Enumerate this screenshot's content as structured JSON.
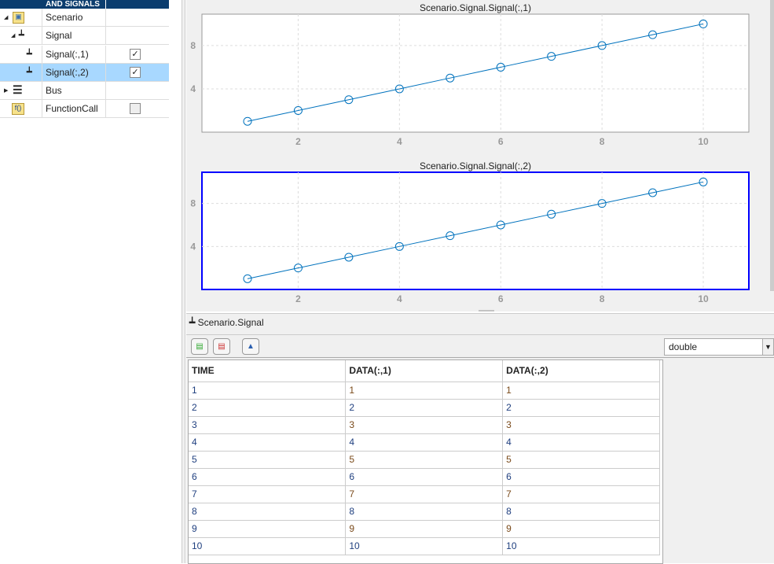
{
  "tree": {
    "header": "AND SIGNALS",
    "items": [
      {
        "label": "Scenario",
        "icon": "scenario-icon",
        "expanded": true
      },
      {
        "label": "Signal",
        "icon": "signal-icon",
        "expanded": true
      },
      {
        "label": "Signal(:,1)",
        "icon": "signal-icon",
        "checked": true
      },
      {
        "label": "Signal(:,2)",
        "icon": "signal-icon",
        "checked": true,
        "selected": true
      },
      {
        "label": "Bus",
        "icon": "bus-icon",
        "expanded": false
      },
      {
        "label": "FunctionCall",
        "icon": "function-call-icon",
        "checked": false
      }
    ]
  },
  "checkmark": "✓",
  "chart_data": [
    {
      "type": "line",
      "title": "Scenario.Signal.Signal(:,1)",
      "x": [
        1,
        2,
        3,
        4,
        5,
        6,
        7,
        8,
        9,
        10
      ],
      "y": [
        1,
        2,
        3,
        4,
        5,
        6,
        7,
        8,
        9,
        10
      ],
      "xticks": [
        2,
        4,
        6,
        8,
        10
      ],
      "yticks": [
        4,
        8
      ],
      "xlim": [
        0.1,
        10.9
      ],
      "ylim": [
        0,
        10.9
      ],
      "grid": true,
      "marker": "circle",
      "color": "#0072bd"
    },
    {
      "type": "line",
      "title": "Scenario.Signal.Signal(:,2)",
      "x": [
        1,
        2,
        3,
        4,
        5,
        6,
        7,
        8,
        9,
        10
      ],
      "y": [
        1,
        2,
        3,
        4,
        5,
        6,
        7,
        8,
        9,
        10
      ],
      "xticks": [
        2,
        4,
        6,
        8,
        10
      ],
      "yticks": [
        4,
        8
      ],
      "xlim": [
        0.1,
        10.9
      ],
      "ylim": [
        0,
        10.9
      ],
      "grid": true,
      "marker": "circle",
      "color": "#0072bd",
      "selected": true
    }
  ],
  "editor": {
    "title": "Scenario.Signal",
    "datatype": "double",
    "columns": [
      "TIME",
      "DATA(:,1)",
      "DATA(:,2)"
    ],
    "rows": [
      [
        "1",
        "1",
        "1"
      ],
      [
        "2",
        "2",
        "2"
      ],
      [
        "3",
        "3",
        "3"
      ],
      [
        "4",
        "4",
        "4"
      ],
      [
        "5",
        "5",
        "5"
      ],
      [
        "6",
        "6",
        "6"
      ],
      [
        "7",
        "7",
        "7"
      ],
      [
        "8",
        "8",
        "8"
      ],
      [
        "9",
        "9",
        "9"
      ],
      [
        "10",
        "10",
        "10"
      ]
    ]
  }
}
